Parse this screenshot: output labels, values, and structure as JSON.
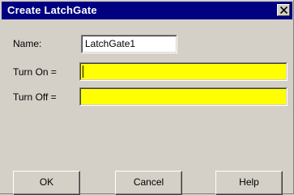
{
  "dialog": {
    "title": "Create LatchGate",
    "close_icon": "close-icon"
  },
  "form": {
    "name_label": "Name:",
    "name_value": "LatchGate1",
    "turn_on_label": "Turn On =",
    "turn_on_value": "",
    "turn_off_label": "Turn Off =",
    "turn_off_value": "",
    "expression_field_color": "#ffff00"
  },
  "buttons": {
    "ok": "OK",
    "cancel": "Cancel",
    "help": "Help"
  }
}
